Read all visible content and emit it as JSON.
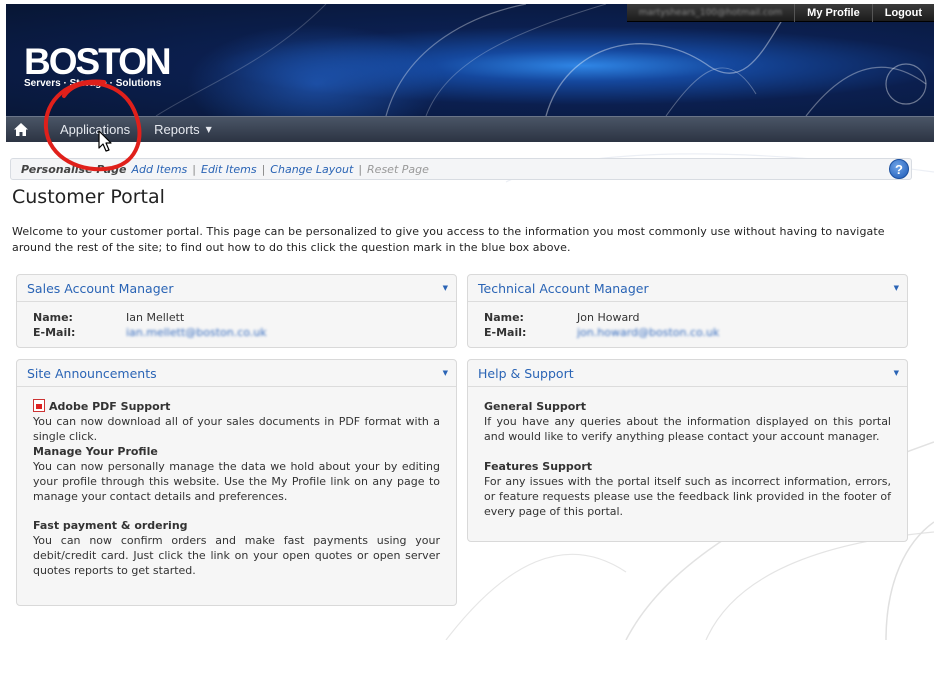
{
  "topbar": {
    "email": "martyshears_100@hotmail.com",
    "my_profile": "My Profile",
    "logout": "Logout"
  },
  "logo": {
    "word": "BOSTON",
    "tagline": "Servers · Storage · Solutions"
  },
  "nav": {
    "applications": "Applications",
    "reports": "Reports"
  },
  "personalise": {
    "label": "Personalise Page",
    "add_items": "Add Items",
    "edit_items": "Edit Items",
    "change_layout": "Change Layout",
    "reset_page": "Reset Page",
    "separator": "|"
  },
  "page": {
    "title": "Customer Portal",
    "intro": "Welcome to your customer portal. This page can be personalized to give you access to the information you most commonly use without having to navigate around the rest of the site; to find out how to do this click the question mark in the blue box above."
  },
  "sales": {
    "title": "Sales Account Manager",
    "name_label": "Name:",
    "name": "Ian Mellett",
    "email_label": "E-Mail:",
    "email": "ian.mellett@boston.co.uk"
  },
  "technical": {
    "title": "Technical Account Manager",
    "name_label": "Name:",
    "name": "Jon Howard",
    "email_label": "E-Mail:",
    "email": "jon.howard@boston.co.uk"
  },
  "announcements": {
    "title": "Site Announcements",
    "items": [
      {
        "title": "Adobe PDF Support",
        "text": "You can now download all of your sales documents in PDF format with a single click."
      },
      {
        "title": "Manage Your Profile",
        "text": "You can now personally manage the data we hold about your by editing your profile through this website. Use the My Profile link on any page to manage your contact details and preferences."
      },
      {
        "title": "Fast payment & ordering",
        "text": "You can now confirm orders and make fast payments using your debit/credit card. Just click the link on your open quotes or open server quotes reports to get started."
      }
    ]
  },
  "help": {
    "title": "Help & Support",
    "items": [
      {
        "title": "General Support",
        "text": "If you have any queries about the information displayed on this portal and would like to verify anything please contact your account manager."
      },
      {
        "title": "Features Support",
        "text": "For any issues with the portal itself such as incorrect information, errors, or feature requests please use the feedback link provided in the footer of every page of this portal."
      }
    ]
  },
  "icons": {
    "home": "home-icon",
    "help": "question-mark-icon",
    "dropdown": "chevron-down-icon",
    "pdf": "pdf-icon"
  },
  "colors": {
    "link": "#2a64b5",
    "annotation": "#e0201b",
    "nav_bg": "#2c3443"
  }
}
